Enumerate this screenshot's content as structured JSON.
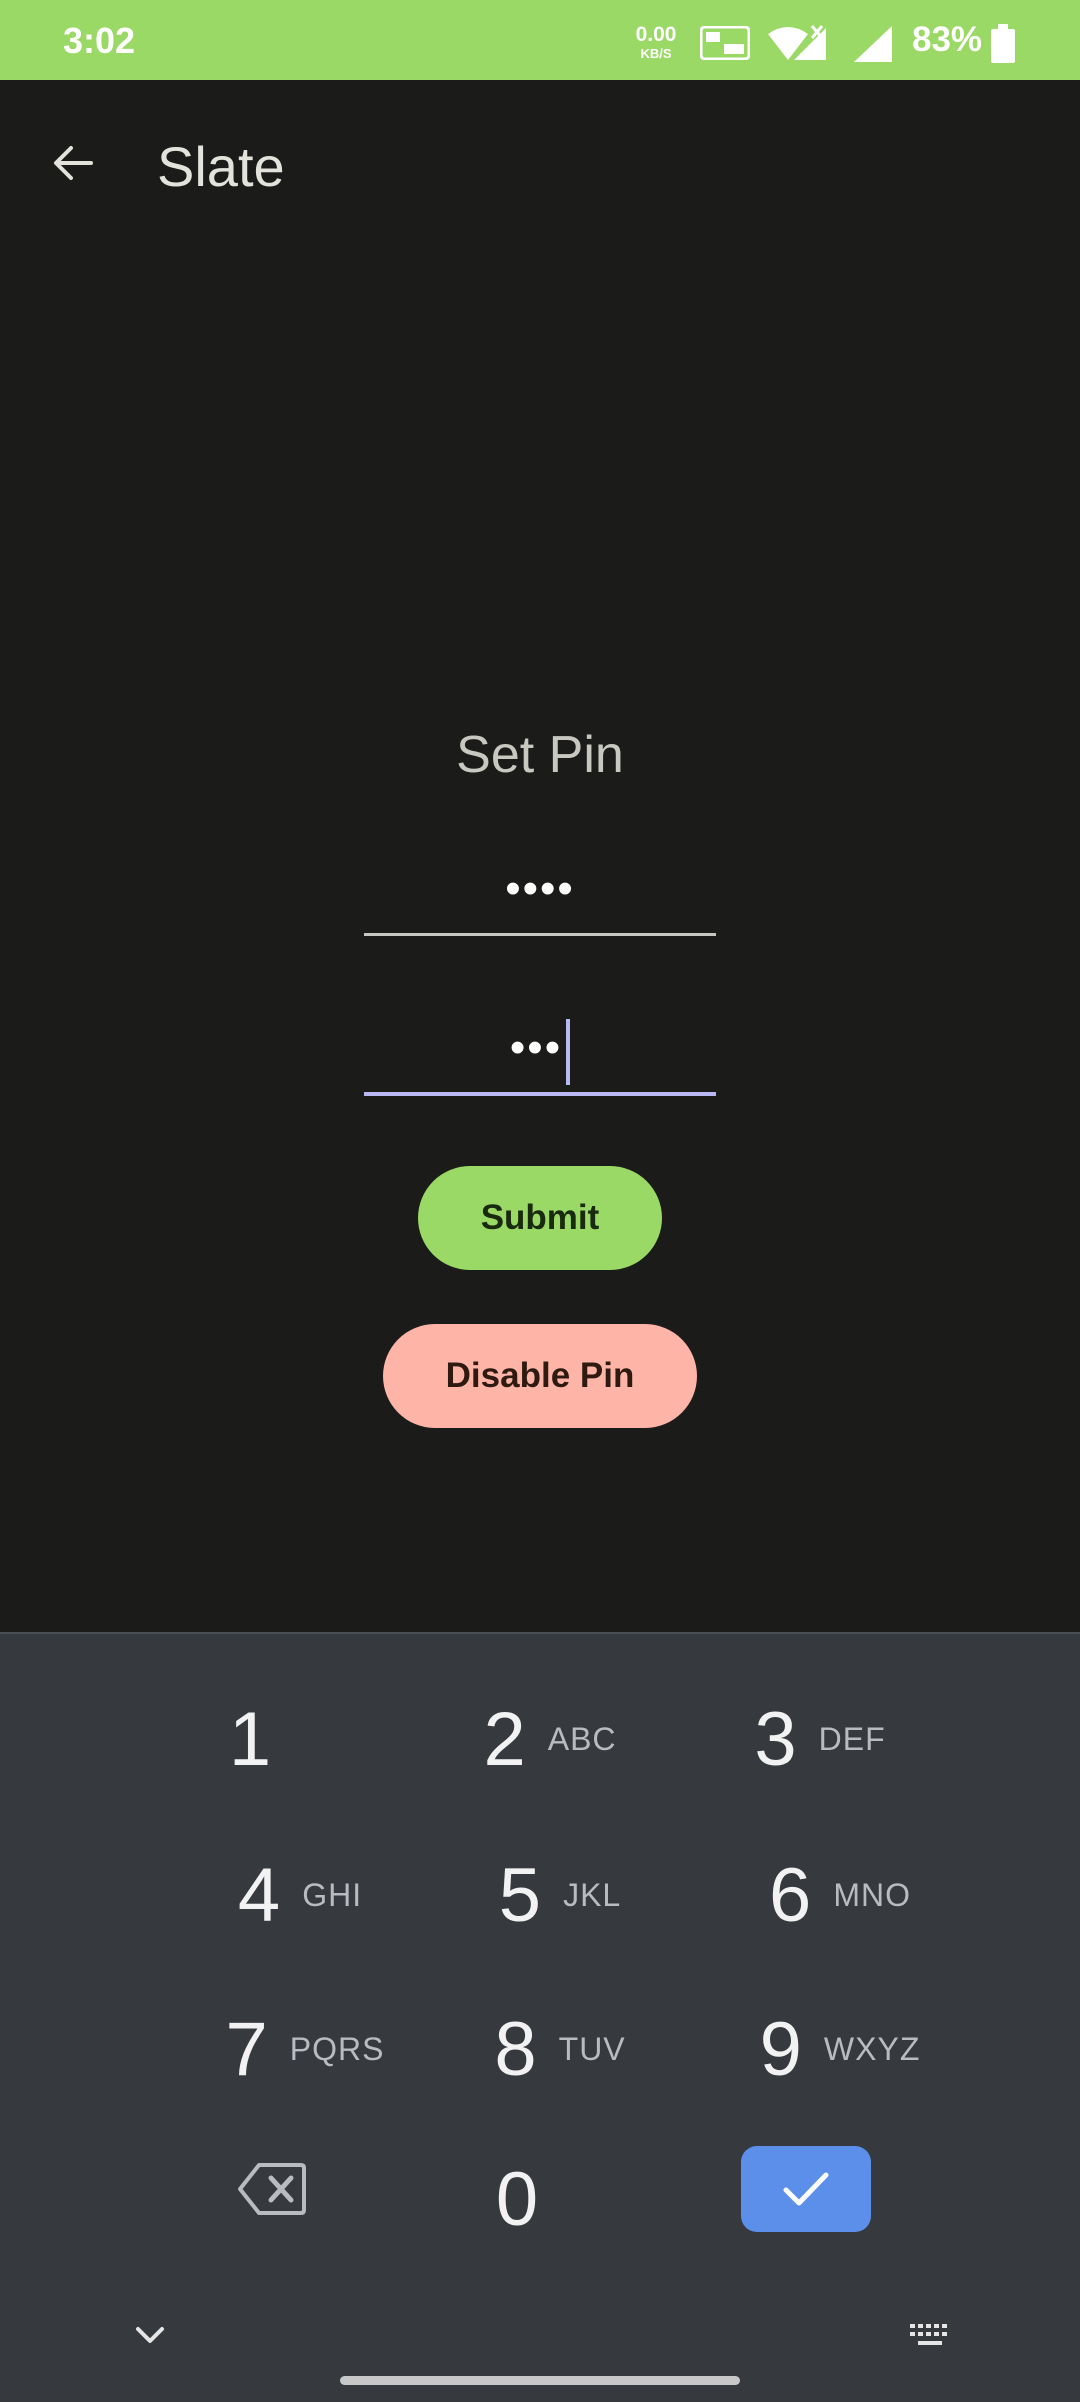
{
  "status_bar": {
    "time": "3:02",
    "net_speed_value": "0.00",
    "net_speed_unit": "KB/S",
    "battery_percent": "83%",
    "icons": [
      "vowifi-icon",
      "wifi-icon",
      "signal-icon",
      "signal-icon",
      "battery-icon"
    ],
    "color": "#9bd966"
  },
  "app_bar": {
    "title": "Slate",
    "back_icon": "arrow-left-icon"
  },
  "pin_form": {
    "title": "Set Pin",
    "pin_masked": "••••",
    "confirm_pin_masked": "•••",
    "submit_label": "Submit",
    "disable_label": "Disable Pin",
    "submit_color": "#9bd966",
    "disable_color": "#ffb4a8",
    "focus_color": "#b9b8f2"
  },
  "keyboard": {
    "keys": [
      {
        "digit": "1",
        "letters": ""
      },
      {
        "digit": "2",
        "letters": "ABC"
      },
      {
        "digit": "3",
        "letters": "DEF"
      },
      {
        "digit": "4",
        "letters": "GHI"
      },
      {
        "digit": "5",
        "letters": "JKL"
      },
      {
        "digit": "6",
        "letters": "MNO"
      },
      {
        "digit": "7",
        "letters": "PQRS"
      },
      {
        "digit": "8",
        "letters": "TUV"
      },
      {
        "digit": "9",
        "letters": "WXYZ"
      },
      {
        "digit": "0",
        "letters": ""
      }
    ],
    "backspace_icon": "backspace-icon",
    "confirm_icon": "check-icon",
    "collapse_icon": "chevron-down-icon",
    "switch_icon": "keyboard-icon",
    "confirm_color": "#5b8fea"
  }
}
